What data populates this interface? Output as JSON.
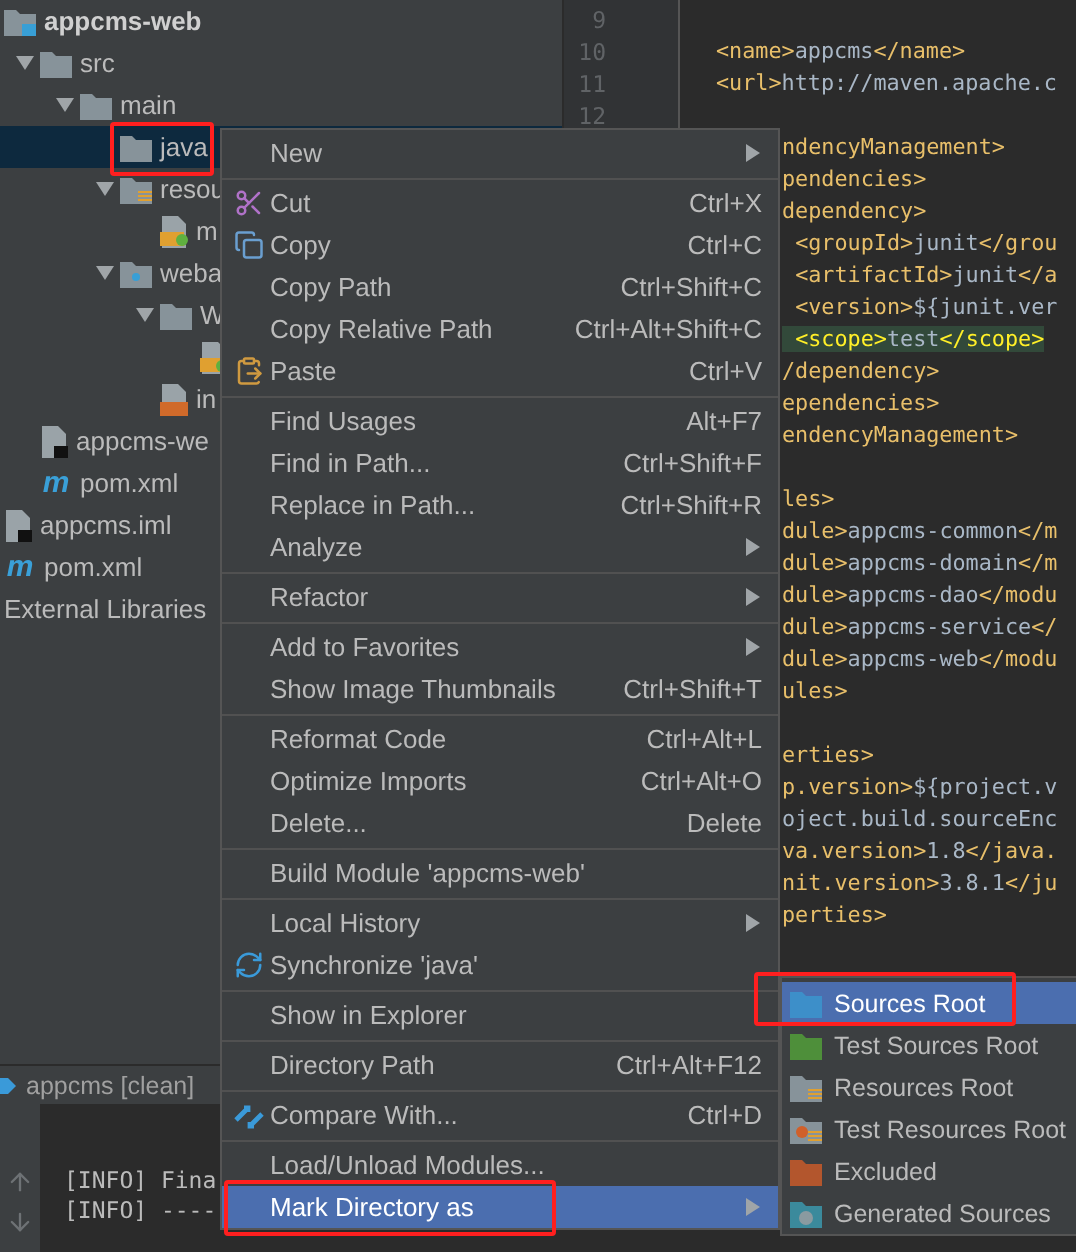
{
  "project_tree": [
    {
      "label": "appcms-web",
      "kind": "module",
      "selected": false,
      "children": [
        {
          "label": "src",
          "kind": "folder",
          "expanded": true,
          "selected": false,
          "children": [
            {
              "label": "main",
              "kind": "folder",
              "expanded": true,
              "selected": false,
              "children": [
                {
                  "label": "java",
                  "kind": "folder",
                  "selected": true,
                  "outlined": true
                },
                {
                  "label": "resou",
                  "kind": "resources",
                  "expanded": true,
                  "selected": false,
                  "children": [
                    {
                      "label": "m",
                      "kind": "xml",
                      "selected": false
                    }
                  ]
                },
                {
                  "label": "weba",
                  "kind": "web",
                  "expanded": true,
                  "selected": false,
                  "children": [
                    {
                      "label": "W",
                      "kind": "folder",
                      "expanded": true,
                      "selected": false,
                      "children": [
                        {
                          "kind": "xml",
                          "selected": false
                        }
                      ]
                    },
                    {
                      "label": "in",
                      "kind": "jsp",
                      "selected": false
                    }
                  ]
                }
              ]
            }
          ]
        },
        {
          "label": "appcms-we",
          "kind": "iml",
          "selected": false
        },
        {
          "label": "pom.xml",
          "kind": "maven",
          "icon_text": "m",
          "selected": false
        }
      ]
    },
    {
      "label": "appcms.iml",
      "kind": "iml",
      "selected": false
    },
    {
      "label": "pom.xml",
      "kind": "maven",
      "icon_text": "m",
      "selected": false
    },
    {
      "label": "External Libraries",
      "kind": "libraries",
      "selected": false
    }
  ],
  "editor": {
    "line_numbers": [
      "9",
      "10",
      "11",
      "12"
    ],
    "lines": [
      {
        "kind": "blank"
      },
      {
        "kind": "full",
        "text": "<name>appcms</name>"
      },
      {
        "kind": "full",
        "text": "<url>http://maven.apache.c"
      },
      {
        "kind": "blank"
      },
      {
        "kind": "clipped",
        "text": "ndencyManagement>"
      },
      {
        "kind": "clipped",
        "text": "pendencies>"
      },
      {
        "kind": "clipped",
        "text": "dependency>"
      },
      {
        "kind": "clipped",
        "text": " <groupId>junit</grou"
      },
      {
        "kind": "clipped",
        "text": " <artifactId>junit</a"
      },
      {
        "kind": "clipped",
        "text": " <version>${junit.ver"
      },
      {
        "kind": "clipped",
        "text": " <scope>test</scope>",
        "highlight": true
      },
      {
        "kind": "clipped",
        "text": "/dependency>"
      },
      {
        "kind": "clipped",
        "text": "ependencies>"
      },
      {
        "kind": "clipped",
        "text": "endencyManagement>"
      },
      {
        "kind": "blank"
      },
      {
        "kind": "clipped",
        "text": "les>"
      },
      {
        "kind": "clipped",
        "text": "dule>appcms-common</m"
      },
      {
        "kind": "clipped",
        "text": "dule>appcms-domain</m"
      },
      {
        "kind": "clipped",
        "text": "dule>appcms-dao</modu"
      },
      {
        "kind": "clipped",
        "text": "dule>appcms-service</"
      },
      {
        "kind": "clipped",
        "text": "dule>appcms-web</modu"
      },
      {
        "kind": "clipped",
        "text": "ules>"
      },
      {
        "kind": "blank"
      },
      {
        "kind": "clipped",
        "text": "erties>"
      },
      {
        "kind": "clipped",
        "text": "p.version>${project.v"
      },
      {
        "kind": "clipped",
        "text": "oject.build.sourceEnc"
      },
      {
        "kind": "clipped",
        "text": "va.version>1.8</java."
      },
      {
        "kind": "clipped",
        "text": "nit.version>3.8.1</ju"
      },
      {
        "kind": "clipped",
        "text": "perties>"
      }
    ]
  },
  "run_panel": {
    "tab": "appcms [clean]",
    "console": [
      "[INFO] Fina",
      "[INFO] ----"
    ]
  },
  "context_menu": [
    [
      {
        "label": "New",
        "kind": "plain",
        "submenu": true,
        "selected": false
      }
    ],
    [
      {
        "label": "Cut",
        "shortcut": "Ctrl+X",
        "kind": "cut",
        "selected": false
      },
      {
        "label": "Copy",
        "shortcut": "Ctrl+C",
        "kind": "copy",
        "selected": false
      },
      {
        "label": "Copy Path",
        "shortcut": "Ctrl+Shift+C",
        "kind": "plain",
        "selected": false
      },
      {
        "label": "Copy Relative Path",
        "shortcut": "Ctrl+Alt+Shift+C",
        "kind": "plain",
        "selected": false
      },
      {
        "label": "Paste",
        "shortcut": "Ctrl+V",
        "kind": "paste",
        "selected": false
      }
    ],
    [
      {
        "label": "Find Usages",
        "shortcut": "Alt+F7",
        "kind": "plain",
        "selected": false
      },
      {
        "label": "Find in Path...",
        "shortcut": "Ctrl+Shift+F",
        "kind": "plain",
        "selected": false
      },
      {
        "label": "Replace in Path...",
        "shortcut": "Ctrl+Shift+R",
        "kind": "plain",
        "selected": false
      },
      {
        "label": "Analyze",
        "kind": "plain",
        "submenu": true,
        "selected": false
      }
    ],
    [
      {
        "label": "Refactor",
        "kind": "plain",
        "submenu": true,
        "selected": false
      }
    ],
    [
      {
        "label": "Add to Favorites",
        "kind": "plain",
        "submenu": true,
        "selected": false
      },
      {
        "label": "Show Image Thumbnails",
        "shortcut": "Ctrl+Shift+T",
        "kind": "plain",
        "selected": false
      }
    ],
    [
      {
        "label": "Reformat Code",
        "shortcut": "Ctrl+Alt+L",
        "kind": "plain",
        "selected": false
      },
      {
        "label": "Optimize Imports",
        "shortcut": "Ctrl+Alt+O",
        "kind": "plain",
        "selected": false
      },
      {
        "label": "Delete...",
        "shortcut": "Delete",
        "kind": "plain",
        "selected": false
      }
    ],
    [
      {
        "label": "Build Module 'appcms-web'",
        "kind": "plain",
        "selected": false
      }
    ],
    [
      {
        "label": "Local History",
        "kind": "plain",
        "submenu": true,
        "selected": false
      },
      {
        "label": "Synchronize 'java'",
        "kind": "sync",
        "selected": false
      }
    ],
    [
      {
        "label": "Show in Explorer",
        "kind": "plain",
        "selected": false
      }
    ],
    [
      {
        "label": "Directory Path",
        "shortcut": "Ctrl+Alt+F12",
        "kind": "plain",
        "selected": false
      }
    ],
    [
      {
        "label": "Compare With...",
        "shortcut": "Ctrl+D",
        "kind": "compare",
        "selected": false
      }
    ],
    [
      {
        "label": "Load/Unload Modules...",
        "kind": "plain",
        "selected": false
      },
      {
        "label": "Mark Directory as",
        "kind": "plain",
        "submenu": true,
        "selected": true,
        "outlined": true
      }
    ]
  ],
  "submenu": [
    {
      "label": "Sources Root",
      "kind": "sources",
      "selected": true,
      "outlined": true
    },
    {
      "label": "Test Sources Root",
      "kind": "test_sources",
      "selected": false
    },
    {
      "label": "Resources Root",
      "kind": "resources",
      "selected": false
    },
    {
      "label": "Test Resources Root",
      "kind": "test_resources",
      "selected": false
    },
    {
      "label": "Excluded",
      "kind": "excluded",
      "selected": false
    },
    {
      "label": "Generated Sources",
      "kind": "generated",
      "selected": false
    }
  ]
}
